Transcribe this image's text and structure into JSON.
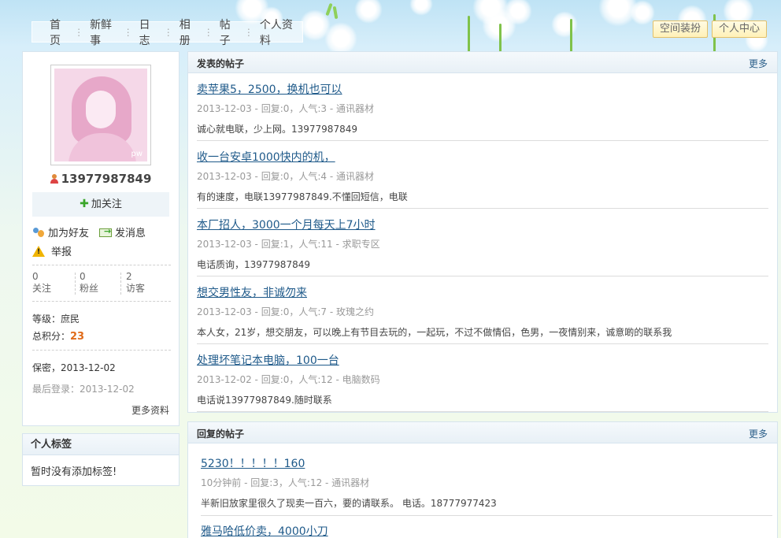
{
  "nav": {
    "items": [
      "首页",
      "新鲜事",
      "日志",
      "相册",
      "帖子",
      "个人资料"
    ]
  },
  "top_buttons": {
    "decorate": "空间装扮",
    "center": "个人中心"
  },
  "profile": {
    "username": "13977987849",
    "avatar_mark": "pw",
    "follow_label": "加关注",
    "add_friend_label": "加为好友",
    "message_label": "发消息",
    "report_label": "举报",
    "stats": [
      {
        "value": "0",
        "label": "关注"
      },
      {
        "value": "0",
        "label": "粉丝"
      },
      {
        "value": "2",
        "label": "访客"
      }
    ],
    "level_label": "等级：",
    "level_value": "庶民",
    "score_label": "总积分：",
    "score_value": "23",
    "privacy_line": "保密，2013-12-02",
    "last_login_label": "最后登录：",
    "last_login_value": "2013-12-02",
    "more_info": "更多资料"
  },
  "tags": {
    "title": "个人标签",
    "empty_text": "暂时没有添加标签!"
  },
  "posted": {
    "title": "发表的帖子",
    "more": "更多",
    "items": [
      {
        "title": "卖苹果5，2500，换机也可以",
        "meta": "2013-12-03 - 回复:0，人气:3 - 通讯器材",
        "body": "诚心就电联，少上网。13977987849"
      },
      {
        "title": "收一台安卓1000快内的机，",
        "meta": "2013-12-03 - 回复:0，人气:4 - 通讯器材",
        "body": "有的速度，电联13977987849.不懂回短信，电联"
      },
      {
        "title": "本厂招人，3000一个月每天上7小时",
        "meta": "2013-12-03 - 回复:1，人气:11 - 求职专区",
        "body": "电话质询，13977987849"
      },
      {
        "title": "想交男性友，非诚勿来",
        "meta": "2013-12-03 - 回复:0，人气:7 - 玫瑰之约",
        "body": "本人女，21岁，想交朋友，可以晚上有节目去玩的，一起玩，不过不做情侣，色男，一夜情别来，诚意啲的联系我"
      },
      {
        "title": "处理坏笔记本电脑，100一台",
        "meta": "2013-12-02 - 回复:0，人气:12 - 电脑数码",
        "body": "电话说13977987849.随时联系"
      }
    ]
  },
  "replied": {
    "title": "回复的帖子",
    "more": "更多",
    "items": [
      {
        "title": "5230！！！！！160",
        "meta": "10分钟前 - 回复:3，人气:12 - 通讯器材",
        "body": "半新旧放家里很久了现卖一百六，要的请联系。 电话。18777977423"
      },
      {
        "title": "雅马哈低价卖，4000小刀",
        "meta": "",
        "body": ""
      }
    ]
  }
}
